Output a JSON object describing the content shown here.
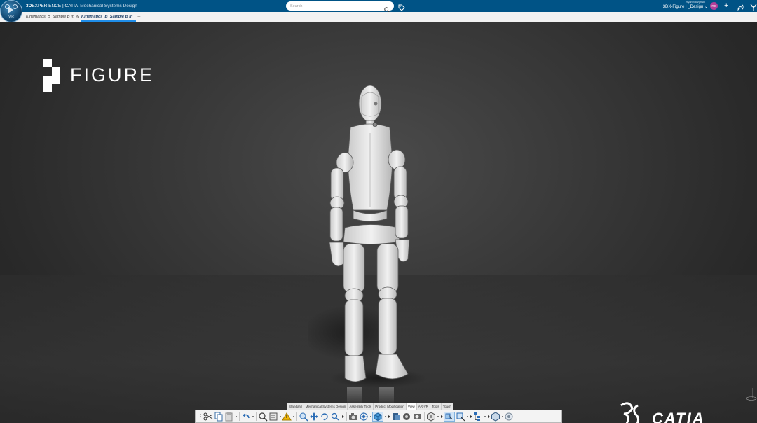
{
  "compass": {
    "version": "V.R"
  },
  "header": {
    "brand_bold": "3D",
    "brand_rest": "EXPERIENCE | CATIA",
    "app_name": "Mechanical Systems Design",
    "search_placeholder": "Search",
    "user_name": "Ryan Skrzyński",
    "context": "3DX-Figure | _Design",
    "avatar_initials": "RS",
    "colors": {
      "bar": "#005386",
      "avatar": "#b33f9a"
    }
  },
  "tabs": [
    {
      "label": "Kinematics_B_Sample B In W"
    },
    {
      "label": "Kinematics_B_Sample B In"
    }
  ],
  "viewport": {
    "brand_logo_text": "FIGURE",
    "catia_logo_text": "CATIA"
  },
  "toolbar": {
    "tabs": [
      "Standard",
      "Mechanical Systems Design",
      "Assembly Tools",
      "Product Modification",
      "View",
      "AR-VR",
      "Tools",
      "Touch"
    ],
    "active_tab": "View"
  }
}
